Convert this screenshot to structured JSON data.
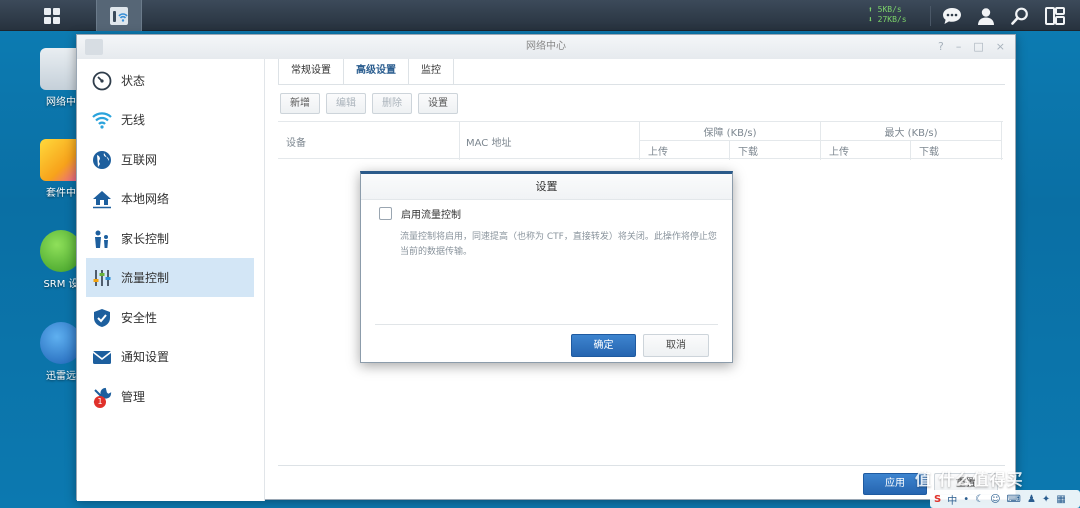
{
  "taskbar": {
    "speed_up": "5KB/s",
    "speed_down": "27KB/s"
  },
  "desktop": {
    "icons": [
      {
        "label": "网络中"
      },
      {
        "label": "套件中"
      },
      {
        "label": "SRM 设"
      },
      {
        "label": "迅雷远"
      }
    ]
  },
  "window": {
    "title": "网络中心",
    "controls": [
      "?",
      "–",
      "□",
      "×"
    ]
  },
  "sidebar": {
    "items": [
      {
        "label": "状态",
        "icon": "gauge-icon"
      },
      {
        "label": "无线",
        "icon": "wifi-icon"
      },
      {
        "label": "互联网",
        "icon": "globe-icon"
      },
      {
        "label": "本地网络",
        "icon": "home-network-icon"
      },
      {
        "label": "家长控制",
        "icon": "parental-icon"
      },
      {
        "label": "流量控制",
        "icon": "sliders-icon"
      },
      {
        "label": "安全性",
        "icon": "shield-icon"
      },
      {
        "label": "通知设置",
        "icon": "envelope-icon"
      },
      {
        "label": "管理",
        "icon": "tools-icon",
        "badge": "1"
      }
    ]
  },
  "tabs": [
    {
      "label": "常规设置"
    },
    {
      "label": "高级设置"
    },
    {
      "label": "监控"
    }
  ],
  "toolbar": {
    "add": "新增",
    "edit": "编辑",
    "delete": "删除",
    "settings": "设置"
  },
  "grid": {
    "col_device": "设备",
    "col_mac": "MAC 地址",
    "col_guarantee": "保障 (KB/s)",
    "col_max": "最大 (KB/s)",
    "upload": "上传",
    "download": "下载"
  },
  "footer": {
    "apply": "应用",
    "reset": "重置"
  },
  "dialog": {
    "title": "设置",
    "checkbox_label": "启用流量控制",
    "description": "流量控制将启用，同速提高（也称为 CTF，直接转发）将关闭。此操作将停止您当前的数据传输。",
    "ok": "确定",
    "cancel": "取消"
  },
  "colors": {
    "accent": "#2665b0",
    "active_row": "#d3e6f6"
  }
}
